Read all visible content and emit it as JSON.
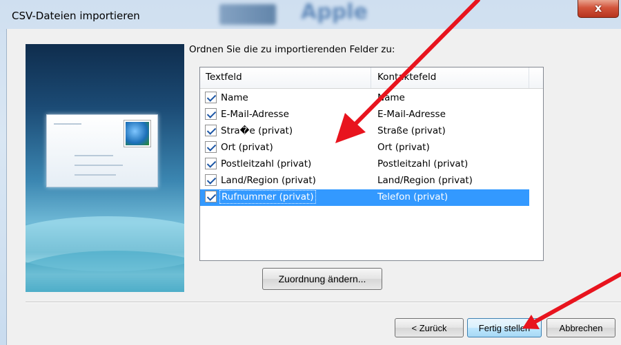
{
  "window": {
    "title": "CSV-Dateien importieren",
    "background_title_text": "Apple",
    "close_label": "x"
  },
  "dialog": {
    "prompt": "Ordnen Sie die zu importierenden Felder zu:",
    "columns": [
      "Textfeld",
      "Kontaktefeld"
    ],
    "rows": [
      {
        "text_field": "Name",
        "contact_field": "Name",
        "checked": true
      },
      {
        "text_field": "E-Mail-Adresse",
        "contact_field": "E-Mail-Adresse",
        "checked": true
      },
      {
        "text_field": "Stra�e (privat)",
        "contact_field": "Straße (privat)",
        "checked": true
      },
      {
        "text_field": "Ort (privat)",
        "contact_field": "Ort (privat)",
        "checked": true
      },
      {
        "text_field": "Postleitzahl (privat)",
        "contact_field": "Postleitzahl (privat)",
        "checked": true
      },
      {
        "text_field": "Land/Region (privat)",
        "contact_field": "Land/Region (privat)",
        "checked": true
      },
      {
        "text_field": "Rufnummer (privat)",
        "contact_field": "Telefon (privat)",
        "checked": true,
        "selected": true
      }
    ],
    "change_mapping_button": "Zuordnung ändern...",
    "back_button": "< Zurück",
    "finish_button": "Fertig stellen",
    "cancel_button": "Abbrechen"
  },
  "colors": {
    "selection": "#3399ff",
    "annotation_arrow": "#e8141e"
  }
}
